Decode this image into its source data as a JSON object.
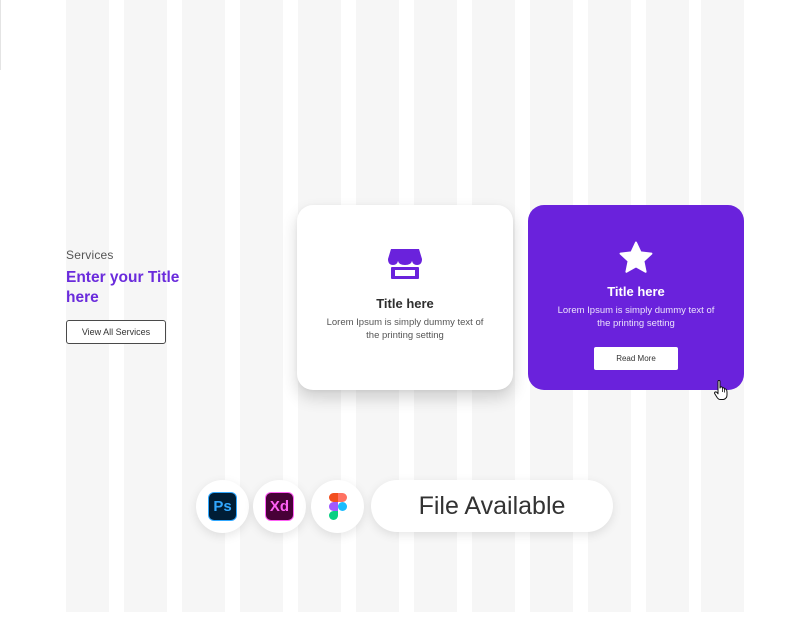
{
  "section": {
    "label": "Services",
    "title": "Enter your Title here",
    "view_all_label": "View All Services"
  },
  "cards": [
    {
      "title": "Title here",
      "description": "Lorem Ipsum is simply dummy text of the printing setting",
      "icon": "store-icon",
      "style": "white"
    },
    {
      "title": "Title here",
      "description": "Lorem Ipsum is simply dummy text of the printing setting",
      "icon": "star-icon",
      "style": "purple",
      "button_label": "Read More"
    }
  ],
  "tools": [
    {
      "label": "Ps",
      "icon": "photoshop-icon"
    },
    {
      "label": "Xd",
      "icon": "adobe-xd-icon"
    },
    {
      "label": "",
      "icon": "figma-icon"
    }
  ],
  "file_available": "File Available",
  "colors": {
    "accent": "#6a22dc",
    "title_accent": "#6a2bdc",
    "background": "#ffffff",
    "stripe": "#f6f6f6",
    "text_dark": "#2e2e2e"
  }
}
